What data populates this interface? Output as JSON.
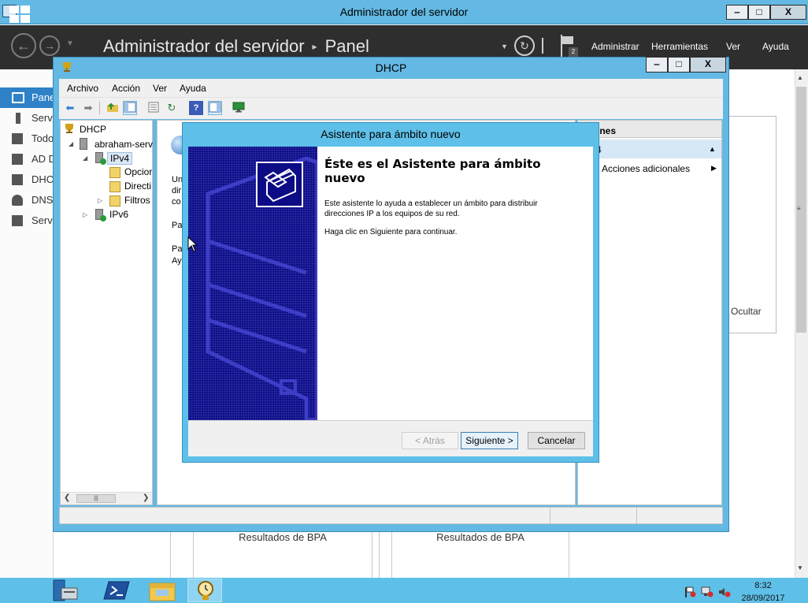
{
  "server_manager": {
    "title": "Administrador del servidor",
    "window_buttons": {
      "minimize": "‒",
      "maximize": "□",
      "close": "X"
    },
    "breadcrumb": {
      "app": "Administrador del servidor",
      "separator": "▸",
      "page": "Panel"
    },
    "menu": {
      "administrar": "Administrar",
      "herramientas": "Herramientas",
      "ver": "Ver",
      "ayuda": "Ayuda"
    },
    "notification_count": "2",
    "sidebar": {
      "items": [
        {
          "label": "Panel",
          "icon": "dashboard-icon"
        },
        {
          "label": "Serv",
          "icon": "server-icon"
        },
        {
          "label": "Todo",
          "icon": "all-servers-icon"
        },
        {
          "label": "AD D",
          "icon": "ad-icon"
        },
        {
          "label": "DHC",
          "icon": "dhcp-icon"
        },
        {
          "label": "DNS",
          "icon": "dns-icon"
        },
        {
          "label": "Serv",
          "icon": "file-services-icon"
        }
      ]
    },
    "ocultar": "Ocultar",
    "bpa": [
      "Resultados de BPA",
      "Resultados de BPA"
    ]
  },
  "dhcp_window": {
    "title": "DHCP",
    "menu": {
      "archivo": "Archivo",
      "accion": "Acción",
      "ver": "Ver",
      "ayuda": "Ayuda"
    },
    "tree": {
      "root": "DHCP",
      "server": "abraham-serv",
      "ipv4": "IPv4",
      "opciones": "Opcior",
      "directivas": "Directi",
      "filtros": "Filtros",
      "ipv6": "IPv6"
    },
    "content_lines": [
      "Un",
      "dir",
      "co",
      "Pa",
      "Pa",
      "Ay"
    ],
    "actions": {
      "header": "ones",
      "section": "4",
      "more": "Acciones adicionales"
    }
  },
  "wizard": {
    "title": "Asistente para ámbito nuevo",
    "heading": "Éste es el Asistente para ámbito nuevo",
    "description": "Este asistente lo ayuda a establecer un ámbito para distribuir direcciones IP a los equipos de su red.",
    "continue_text": "Haga clic en Siguiente para continuar.",
    "buttons": {
      "back": "< Atrás",
      "next": "Siguiente >",
      "cancel": "Cancelar"
    }
  },
  "taskbar": {
    "time": "8:32",
    "date": "28/09/2017"
  },
  "colors": {
    "accent": "#2f82c7",
    "titlebar": "#63b9e3",
    "header_dark": "#2e2e2e",
    "wizard_banner": "#0c0c86"
  }
}
